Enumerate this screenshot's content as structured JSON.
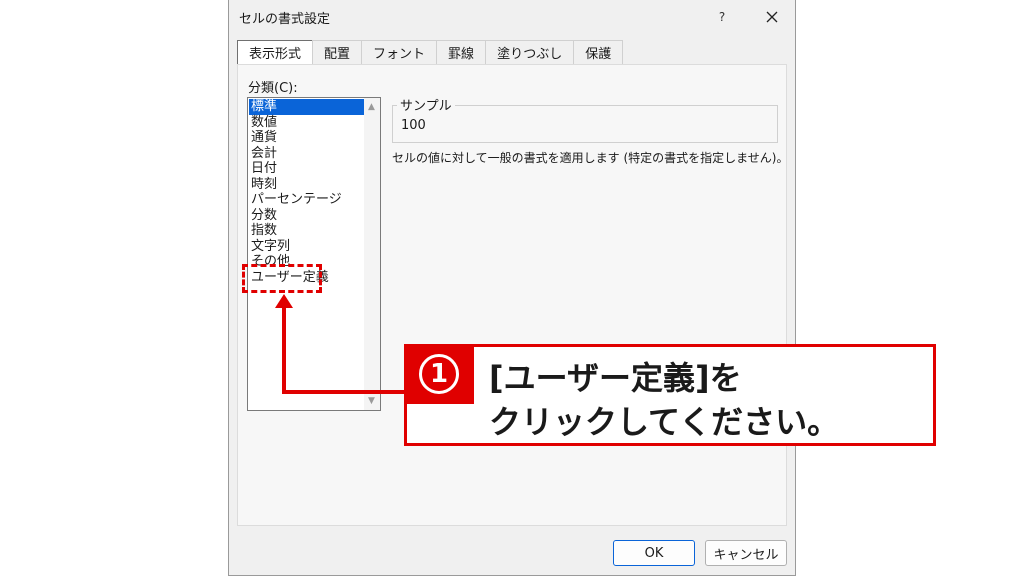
{
  "dialog": {
    "title": "セルの書式設定",
    "help_label": "?",
    "tabs": [
      {
        "label": "表示形式",
        "active": true
      },
      {
        "label": "配置"
      },
      {
        "label": "フォント"
      },
      {
        "label": "罫線"
      },
      {
        "label": "塗りつぶし"
      },
      {
        "label": "保護"
      }
    ],
    "category_label": "分類(C):",
    "categories": [
      {
        "label": "標準",
        "selected": true
      },
      {
        "label": "数値"
      },
      {
        "label": "通貨"
      },
      {
        "label": "会計"
      },
      {
        "label": "日付"
      },
      {
        "label": "時刻"
      },
      {
        "label": "パーセンテージ"
      },
      {
        "label": "分数"
      },
      {
        "label": "指数"
      },
      {
        "label": "文字列"
      },
      {
        "label": "その他"
      },
      {
        "label": "ユーザー定義"
      }
    ],
    "sample_label": "サンプル",
    "sample_value": "100",
    "description": "セルの値に対して一般の書式を適用します (特定の書式を指定しません)。",
    "ok_label": "OK",
    "cancel_label": "キャンセル"
  },
  "annotation": {
    "step_number": "1",
    "line1": "[ユーザー定義]を",
    "line2": "クリックしてください。",
    "accent_color": "#e00000"
  }
}
